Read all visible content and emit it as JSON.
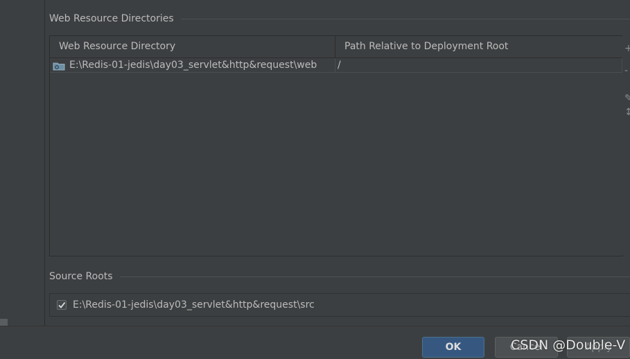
{
  "web_resources": {
    "section_title": "Web Resource Directories",
    "columns": [
      "Web Resource Directory",
      "Path Relative to Deployment Root"
    ],
    "rows": [
      {
        "directory": "E:\\Redis-01-jedis\\day03_servlet&http&request\\web",
        "path": "/"
      }
    ]
  },
  "source_roots": {
    "section_title": "Source Roots",
    "items": [
      {
        "path": "E:\\Redis-01-jedis\\day03_servlet&http&request\\src",
        "checked": true
      }
    ]
  },
  "buttons": {
    "ok": "OK",
    "cancel": "Cancel",
    "apply": "Apply"
  },
  "watermark": "CSDN @Double-V",
  "colors": {
    "background": "#3c3f41",
    "primary_button": "#365880",
    "text": "#bbbbbb"
  }
}
